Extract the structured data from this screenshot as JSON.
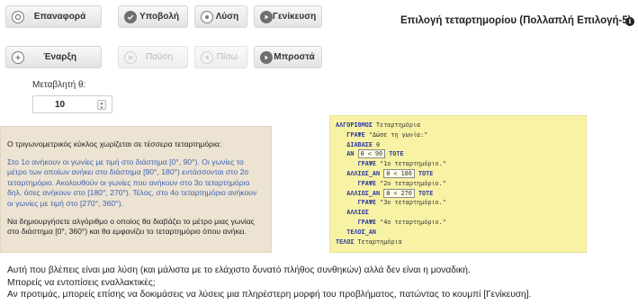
{
  "toolbar": {
    "row1": [
      {
        "name": "reset-button",
        "label": "Επαναφορά",
        "icon": "reset-icon"
      },
      {
        "name": "submit-button",
        "label": "Υποβολή",
        "icon": "check-icon"
      },
      {
        "name": "solution-button",
        "label": "Λύση",
        "icon": "solution-icon"
      },
      {
        "name": "generalize-button",
        "label": "Γενίκευση",
        "icon": "play-icon"
      }
    ],
    "row2": [
      {
        "name": "start-button",
        "label": "Έναρξη",
        "icon": "start-icon"
      },
      {
        "name": "pause-button",
        "label": "Παύση",
        "icon": "pause-icon"
      },
      {
        "name": "back-button",
        "label": "Πίσω",
        "icon": "back-icon"
      },
      {
        "name": "forward-button",
        "label": "Μπροστά",
        "icon": "forward-icon"
      }
    ]
  },
  "header": {
    "title": "Επιλογή τεταρτημορίου (Πολλαπλή Επιλογή-5)",
    "info_icon": "i"
  },
  "variable": {
    "label": "Μεταβλητή θ:",
    "value": "10"
  },
  "problem": {
    "intro": "Ο τριγωνομετρικός κύκλος χωρίζεται σε τέσσερα τεταρτημόρια:",
    "details": "Στο 1ο ανήκουν οι γωνίες με τιμή στο διάστημα [0°, 90°). Οι γωνίες το μέτρο των οποίων ανήκει στο διάστημα [90°, 180°) εντάσσονται στο 2ο τεταρτημόριο. Ακολουθούν οι γωνίες που ανήκουν στο 3ο τεταρτημόριο δηλ. όσες ανήκουν στο [180°, 270°). Τέλος, στο 4ο τεταρτημόριο ανήκουν οι γωνίες με τιμή στο [270°, 360°).",
    "task": "Να δημιουργήσετε αλγόριθμο ο οποίος θα διαβάζει το μέτρο μιας γωνίας στο διάστημα [0°, 360°) και θα εμφανίζει το τεταρτημόριο όπου ανήκει."
  },
  "code": {
    "l1_kw": "ΑΛΓΟΡΙΘΜΟΣ",
    "l1_rest": " Τεταρτημόρια",
    "l2_kw": "ΓΡΑΨΕ",
    "l2_str": " \"Δώσε τη γωνία:\"",
    "l3_kw": "ΔΙΑΒΑΣΕ",
    "l3_rest": " θ",
    "l4_kw": "ΑΝ",
    "l4_cond": "θ < 90",
    "l4_end": "ΤΟΤΕ",
    "l5_kw": "ΓΡΑΨΕ",
    "l5_str": " \"1ο τεταρτημόριο.\"",
    "l6_kw": "ΑΛΛΙΩΣ_ΑΝ",
    "l6_cond": "θ < 180",
    "l6_end": "ΤΟΤΕ",
    "l7_kw": "ΓΡΑΨΕ",
    "l7_str": " \"2ο τεταρτημόριο.\"",
    "l8_kw": "ΑΛΛΙΩΣ_ΑΝ",
    "l8_cond": "θ < 270",
    "l8_end": "ΤΟΤΕ",
    "l9_kw": "ΓΡΑΨΕ",
    "l9_str": " \"3ο τεταρτημόριο.\"",
    "l10_kw": "ΑΛΛΙΩΣ",
    "l11_kw": "ΓΡΑΨΕ",
    "l11_str": " \"4ο τεταρτημόριο.\"",
    "l12_kw": "ΤΕΛΟΣ_ΑΝ",
    "l13_kw": "ΤΕΛΟΣ",
    "l13_rest": " Τεταρτημόρια"
  },
  "footer": {
    "line1": "Αυτή που βλέπεις είναι μια λύση (και μάλιστα με το ελάχιστο δυνατό πλήθος συνθηκών) αλλά δεν είναι η μοναδική.",
    "line2": "Μπορείς να εντοπίσεις εναλλακτικές;",
    "line3": "Αν προτιμάς, μπορείς επίσης να δοκιμάσεις να λύσεις μια πληρέστερη μορφή του προβλήματος, πατώντας το κουμπί [Γενίκευση]."
  }
}
